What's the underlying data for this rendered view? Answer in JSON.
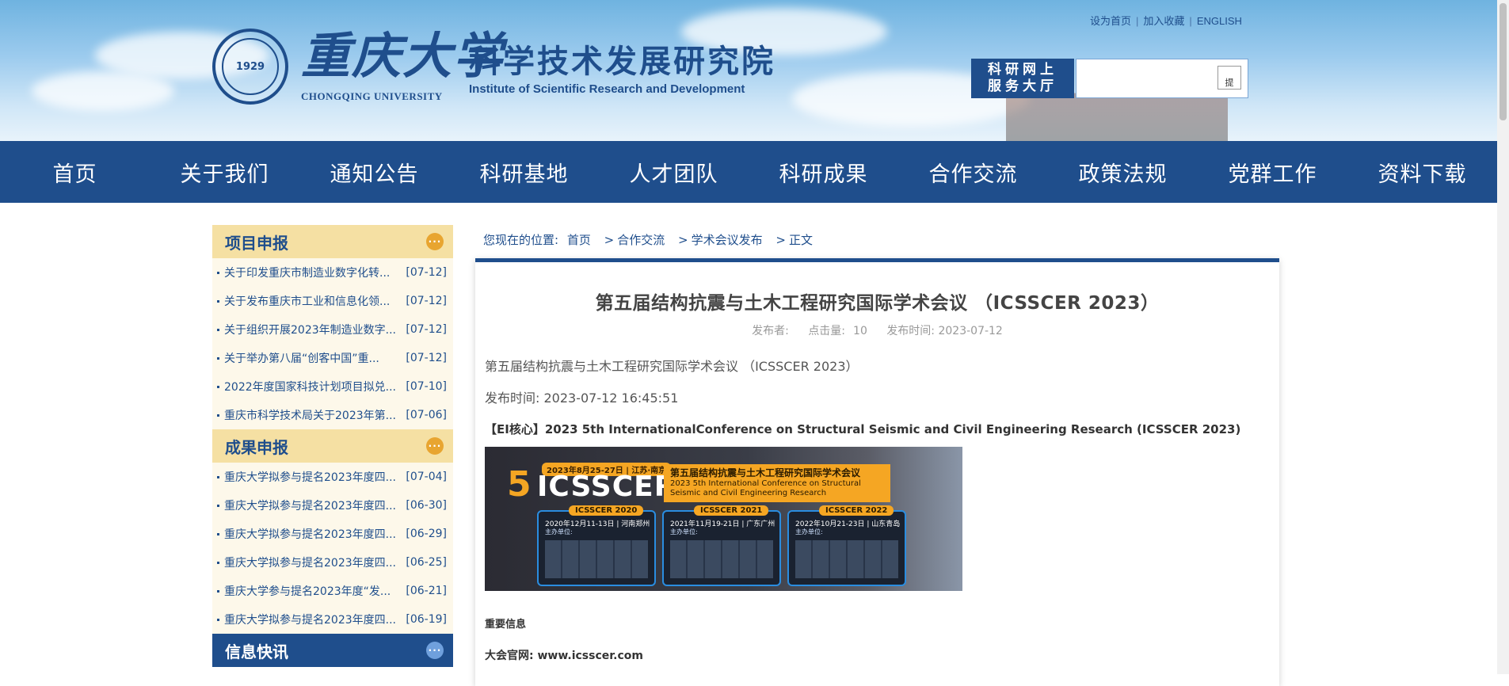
{
  "header": {
    "seal_text": "1929",
    "logo_cn": "重庆大学",
    "logo_en": "CHONGQING UNIVERSITY",
    "institute_cn": "科学技术发展研究院",
    "institute_en": "Institute of Scientific Research and Development",
    "top_links": [
      "设为首页",
      "加入收藏",
      "ENGLISH"
    ],
    "portal_line1": "科研网上",
    "portal_line2": "服务大厅",
    "search_button_alt": "提"
  },
  "nav": [
    "首页",
    "关于我们",
    "通知公告",
    "科研基地",
    "人才团队",
    "科研成果",
    "合作交流",
    "政策法规",
    "党群工作",
    "资料下载"
  ],
  "sidebar": {
    "sections": [
      {
        "title": "项目申报",
        "items": [
          {
            "text": "关于印发重庆市制造业数字化转...",
            "date": "[07-12]"
          },
          {
            "text": "关于发布重庆市工业和信息化领...",
            "date": "[07-12]"
          },
          {
            "text": "关于组织开展2023年制造业数字...",
            "date": "[07-12]"
          },
          {
            "text": "关于举办第八届“创客中国”重...",
            "date": "[07-12]"
          },
          {
            "text": "2022年度国家科技计划项目拟兑...",
            "date": "[07-10]"
          },
          {
            "text": "重庆市科学技术局关于2023年第...",
            "date": "[07-06]"
          }
        ]
      },
      {
        "title": "成果申报",
        "items": [
          {
            "text": "重庆大学拟参与提名2023年度四...",
            "date": "[07-04]"
          },
          {
            "text": "重庆大学拟参与提名2023年度四...",
            "date": "[06-30]"
          },
          {
            "text": "重庆大学拟参与提名2023年度四...",
            "date": "[06-29]"
          },
          {
            "text": "重庆大学拟参与提名2023年度四...",
            "date": "[06-25]"
          },
          {
            "text": "重庆大学参与提名2023年度“发...",
            "date": "[06-21]"
          },
          {
            "text": "重庆大学拟参与提名2023年度四...",
            "date": "[06-19]"
          }
        ]
      },
      {
        "title": "信息快讯",
        "items": []
      }
    ],
    "more_symbol": "···"
  },
  "breadcrumb": {
    "label": "您现在的位置:",
    "items": [
      "首页",
      "合作交流",
      "学术会议发布",
      "正文"
    ],
    "sep": ">"
  },
  "article": {
    "title": "第五届结构抗震与土木工程研究国际学术会议 （ICSSCER 2023）",
    "meta_publisher": "发布者:",
    "meta_clicks_label": "点击量:",
    "meta_clicks": "10",
    "meta_time": "发布时间: 2023-07-12",
    "para1": "第五届结构抗震与土木工程研究国际学术会议 （ICSSCER 2023）",
    "para2": "发布时间: 2023-07-12 16:45:51",
    "para3": "【EI核心】2023 5th InternationalConference on Structural Seismic and Civil Engineering Research (ICSSCER 2023)",
    "banner": {
      "num": "5",
      "name": "ICSSCER 2023",
      "date": "2023年8月25-27日 | 江苏·南京",
      "right_cn": "第五届结构抗震与土木工程研究国际学术会议",
      "right_en": "2023 5th International Conference on Structural Seismic and Civil Engineering Research",
      "panels": [
        {
          "head": "ICSSCER 2020",
          "line": "2020年12月11-13日 | 河南郑州",
          "sub": "主办单位:"
        },
        {
          "head": "ICSSCER 2021",
          "line": "2021年11月19-21日 | 广东广州",
          "sub": "主办单位:"
        },
        {
          "head": "ICSSCER 2022",
          "line": "2022年10月21-23日 | 山东青岛",
          "sub": "主办单位:"
        }
      ]
    },
    "para4": "重要信息",
    "para5": "大会官网: www.icsscer.com"
  }
}
